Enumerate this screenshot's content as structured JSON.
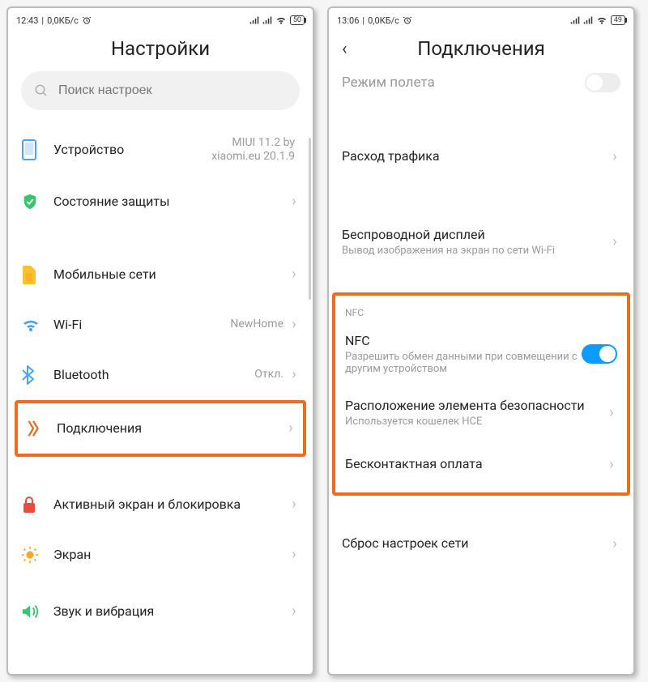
{
  "left": {
    "statusbar": {
      "time": "12:43",
      "speed": "0,0КБ/с",
      "alarm": true,
      "battery": "50"
    },
    "title": "Настройки",
    "search_placeholder": "Поиск настроек",
    "items": [
      {
        "icon": "device",
        "label": "Устройство",
        "value": "MIUI 11.2 by xiaomi.eu 20.1.9",
        "chev": true
      },
      {
        "icon": "shield",
        "label": "Состояние защиты",
        "chev": true
      }
    ],
    "items2": [
      {
        "icon": "sim",
        "label": "Мобильные сети",
        "chev": true
      },
      {
        "icon": "wifi",
        "label": "Wi-Fi",
        "value": "NewHome",
        "chev": true
      },
      {
        "icon": "bt",
        "label": "Bluetooth",
        "value": "Откл.",
        "chev": true
      }
    ],
    "highlight": {
      "icon": "conn",
      "label": "Подключения",
      "chev": true
    },
    "items3": [
      {
        "icon": "lock",
        "label": "Активный экран и блокировка",
        "chev": true
      },
      {
        "icon": "sun",
        "label": "Экран",
        "chev": true
      },
      {
        "icon": "sound",
        "label": "Звук и вибрация",
        "chev": true
      }
    ]
  },
  "right": {
    "statusbar": {
      "time": "13:06",
      "speed": "0,0КБ/с",
      "alarm": true,
      "battery": "49"
    },
    "title": "Подключения",
    "partial_top": "Режим полета",
    "items": [
      {
        "label": "Расход трафика",
        "chev": true
      },
      {
        "label": "Беспроводной дисплей",
        "sub": "Вывод изображения на экран по сети Wi-Fi",
        "chev": true
      }
    ],
    "nfc_section": "NFC",
    "nfc_items": [
      {
        "label": "NFC",
        "sub": "Разрешить обмен данными при совмещении с другим устройством",
        "toggle": true
      },
      {
        "label": "Расположение элемента безопасности",
        "sub": "Используется кошелек HCE",
        "chev": true
      },
      {
        "label": "Бесконтактная оплата",
        "chev": true
      }
    ],
    "items2": [
      {
        "label": "Сброс настроек сети",
        "chev": true
      }
    ]
  }
}
